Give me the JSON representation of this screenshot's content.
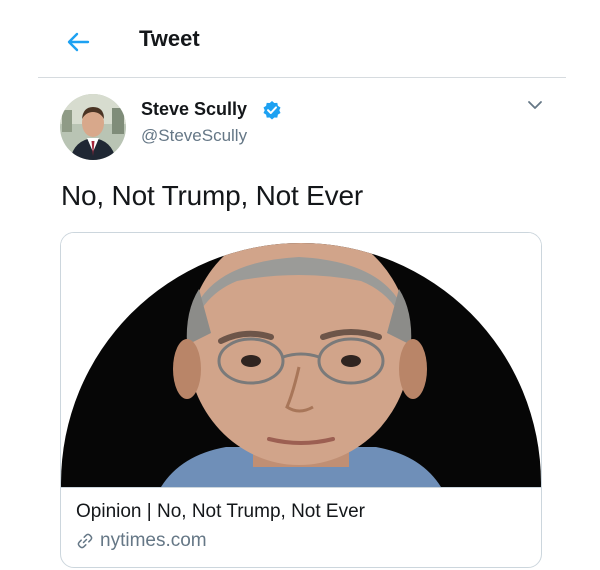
{
  "header": {
    "back_icon": "arrow-left-icon",
    "title": "Tweet"
  },
  "tweet": {
    "author": {
      "name": "Steve Scully",
      "handle": "@SteveScully",
      "verified": true,
      "avatar_icon": "profile-photo"
    },
    "more_icon": "chevron-down-icon",
    "text": "No, Not Trump, Not Ever",
    "card": {
      "image_icon": "portrait-photo",
      "title": "Opinion | No, Not Trump, Not Ever",
      "link_icon": "link-icon",
      "domain": "nytimes.com"
    }
  },
  "colors": {
    "accent": "#1da1f2",
    "text_primary": "#14171a",
    "text_secondary": "#657786",
    "border": "#ccd6dd"
  }
}
